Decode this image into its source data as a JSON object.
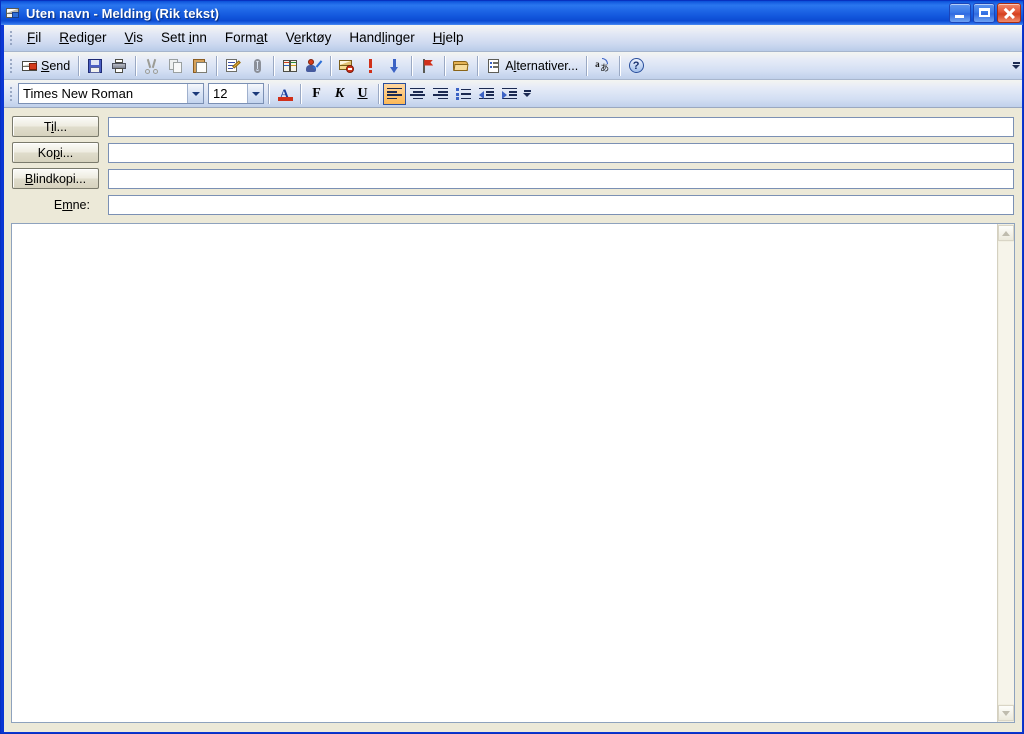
{
  "window": {
    "title": "Uten navn - Melding (Rik tekst)",
    "icon": "message-envelope-icon",
    "controls": {
      "minimize": "Minimer",
      "maximize": "Maksimer",
      "close": "Lukk"
    }
  },
  "menubar": {
    "items": [
      {
        "label": "Fil",
        "pre": "",
        "accel": "F",
        "post": "il"
      },
      {
        "label": "Rediger",
        "pre": "",
        "accel": "R",
        "post": "ediger"
      },
      {
        "label": "Vis",
        "pre": "",
        "accel": "V",
        "post": "is"
      },
      {
        "label": "Sett inn",
        "pre": "Sett ",
        "accel": "i",
        "post": "nn"
      },
      {
        "label": "Format",
        "pre": "Form",
        "accel": "a",
        "post": "t"
      },
      {
        "label": "Verktøy",
        "pre": "V",
        "accel": "e",
        "post": "rktøy"
      },
      {
        "label": "Handlinger",
        "pre": "Hand",
        "accel": "l",
        "post": "inger"
      },
      {
        "label": "Hjelp",
        "pre": "",
        "accel": "H",
        "post": "jelp"
      }
    ]
  },
  "toolbar_standard": {
    "send": {
      "label_pre": "",
      "accel": "S",
      "label_post": "end",
      "icon": "send-envelope-icon"
    },
    "buttons": [
      {
        "name": "save-button",
        "icon": "floppy-disk-icon",
        "enabled": true
      },
      {
        "name": "print-button",
        "icon": "printer-icon",
        "enabled": true
      },
      {
        "name": "cut-button",
        "icon": "scissors-icon",
        "enabled": false
      },
      {
        "name": "copy-button",
        "icon": "copy-pages-icon",
        "enabled": false
      },
      {
        "name": "paste-button",
        "icon": "clipboard-paste-icon",
        "enabled": true
      },
      {
        "name": "format-painter-button",
        "icon": "page-pen-icon",
        "enabled": true
      },
      {
        "name": "attach-file-button",
        "icon": "paperclip-icon",
        "enabled": true
      },
      {
        "name": "address-book-button",
        "icon": "open-book-icon",
        "enabled": true
      },
      {
        "name": "check-names-button",
        "icon": "person-check-icon",
        "enabled": true
      },
      {
        "name": "block-sender-button",
        "icon": "envelope-block-icon",
        "enabled": true
      },
      {
        "name": "high-importance-button",
        "icon": "exclamation-icon",
        "enabled": true
      },
      {
        "name": "low-importance-button",
        "icon": "down-arrow-icon",
        "enabled": true
      },
      {
        "name": "follow-up-flag-button",
        "icon": "red-flag-icon",
        "enabled": true
      },
      {
        "name": "folder-button",
        "icon": "open-folder-icon",
        "enabled": true
      }
    ],
    "options": {
      "label_pre": "A",
      "accel": "l",
      "label_post": "ternativer...",
      "icon": "options-page-icon"
    },
    "language": {
      "name": "language-button",
      "icon": "language-translate-icon"
    },
    "help": {
      "name": "help-button",
      "icon": "question-circle-icon"
    },
    "overflow": {
      "name": "toolbar-overflow-button",
      "icon": "chevron-down-icon"
    }
  },
  "toolbar_format": {
    "font": {
      "value": "Times New Roman",
      "name": "font-family-combo"
    },
    "size": {
      "value": "12",
      "name": "font-size-combo"
    },
    "font_color": {
      "name": "font-color-button",
      "glyph": "A",
      "color": "#d0301a"
    },
    "bold": {
      "label": "F",
      "name": "bold-button"
    },
    "italic": {
      "label": "K",
      "name": "italic-button"
    },
    "underline": {
      "label": "U",
      "name": "underline-button"
    },
    "align_left": {
      "name": "align-left-button",
      "active": true
    },
    "align_center": {
      "name": "align-center-button",
      "active": false
    },
    "align_right": {
      "name": "align-right-button",
      "active": false
    },
    "bullets": {
      "name": "bullets-button"
    },
    "decrease_indent": {
      "name": "decrease-indent-button"
    },
    "increase_indent": {
      "name": "increase-indent-button"
    },
    "overflow": {
      "name": "format-toolbar-overflow-button"
    }
  },
  "headers": {
    "to": {
      "button_pre": "T",
      "accel": "i",
      "button_post": "l...",
      "value": ""
    },
    "cc": {
      "button_pre": "Ko",
      "accel": "p",
      "button_post": "i...",
      "value": ""
    },
    "bcc": {
      "button_pre": "",
      "accel": "B",
      "button_post": "lindkopi...",
      "value": ""
    },
    "subject": {
      "label_pre": "E",
      "accel": "m",
      "label_post": "ne:",
      "value": ""
    }
  },
  "body": {
    "text": "",
    "scroll": {
      "up": "scroll-up-arrow",
      "down": "scroll-down-arrow"
    }
  },
  "colors": {
    "titlebar_blue": "#1b63e4",
    "window_frame": "#0a36d4",
    "client_bg": "#ece9d8",
    "toolbar_gradient_top": "#f4f5f1",
    "toolbar_gradient_bottom": "#c0d0ea",
    "active_button_orange": "#fbb856",
    "field_border": "#7b90b4",
    "close_button_red": "#d5401f"
  }
}
